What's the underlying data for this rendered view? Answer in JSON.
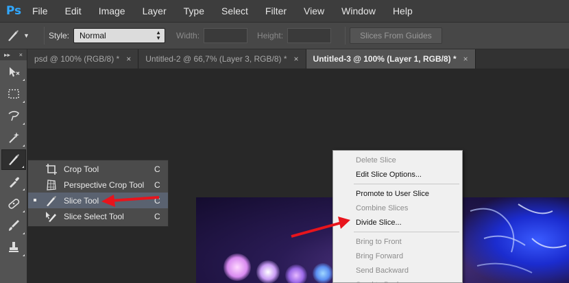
{
  "app": {
    "logo": "Ps",
    "accent": "#31a8ff"
  },
  "menubar": {
    "items": [
      "File",
      "Edit",
      "Image",
      "Layer",
      "Type",
      "Select",
      "Filter",
      "View",
      "Window",
      "Help"
    ]
  },
  "options": {
    "style_label": "Style:",
    "style_value": "Normal",
    "width_label": "Width:",
    "height_label": "Height:",
    "slices_button": "Slices From Guides"
  },
  "tabs": [
    {
      "label": "psd @ 100% (RGB/8) *",
      "close": "×",
      "active": false
    },
    {
      "label": "Untitled-2 @ 66,7% (Layer 3, RGB/8) *",
      "close": "×",
      "active": false
    },
    {
      "label": "Untitled-3 @ 100% (Layer 1, RGB/8) *",
      "close": "×",
      "active": true
    }
  ],
  "panel": {
    "collapse": "▸▸",
    "close": "×"
  },
  "tools": [
    "move-icon",
    "marquee-icon",
    "lasso-icon",
    "magic-wand-icon",
    "slice-icon",
    "eyedropper-icon",
    "healing-brush-icon",
    "brush-icon",
    "stamp-icon"
  ],
  "flyout": {
    "items": [
      {
        "label": "Crop Tool",
        "key": "C",
        "icon": "crop-icon",
        "selected": false
      },
      {
        "label": "Perspective Crop Tool",
        "key": "C",
        "icon": "perspective-crop-icon",
        "selected": false
      },
      {
        "label": "Slice Tool",
        "key": "C",
        "icon": "slice-icon",
        "selected": true
      },
      {
        "label": "Slice Select Tool",
        "key": "C",
        "icon": "slice-select-icon",
        "selected": false
      }
    ]
  },
  "context_menu": {
    "items": [
      {
        "label": "Delete Slice",
        "enabled": false
      },
      {
        "label": "Edit Slice Options...",
        "enabled": true
      },
      {
        "separator": true
      },
      {
        "label": "Promote to User Slice",
        "enabled": true
      },
      {
        "label": "Combine Slices",
        "enabled": false
      },
      {
        "label": "Divide Slice...",
        "enabled": true
      },
      {
        "separator": true
      },
      {
        "label": "Bring to Front",
        "enabled": false
      },
      {
        "label": "Bring Forward",
        "enabled": false
      },
      {
        "label": "Send Backward",
        "enabled": false
      },
      {
        "label": "Send to Back",
        "enabled": false
      }
    ]
  },
  "annotations": {
    "arrow_color": "#e8141c"
  }
}
